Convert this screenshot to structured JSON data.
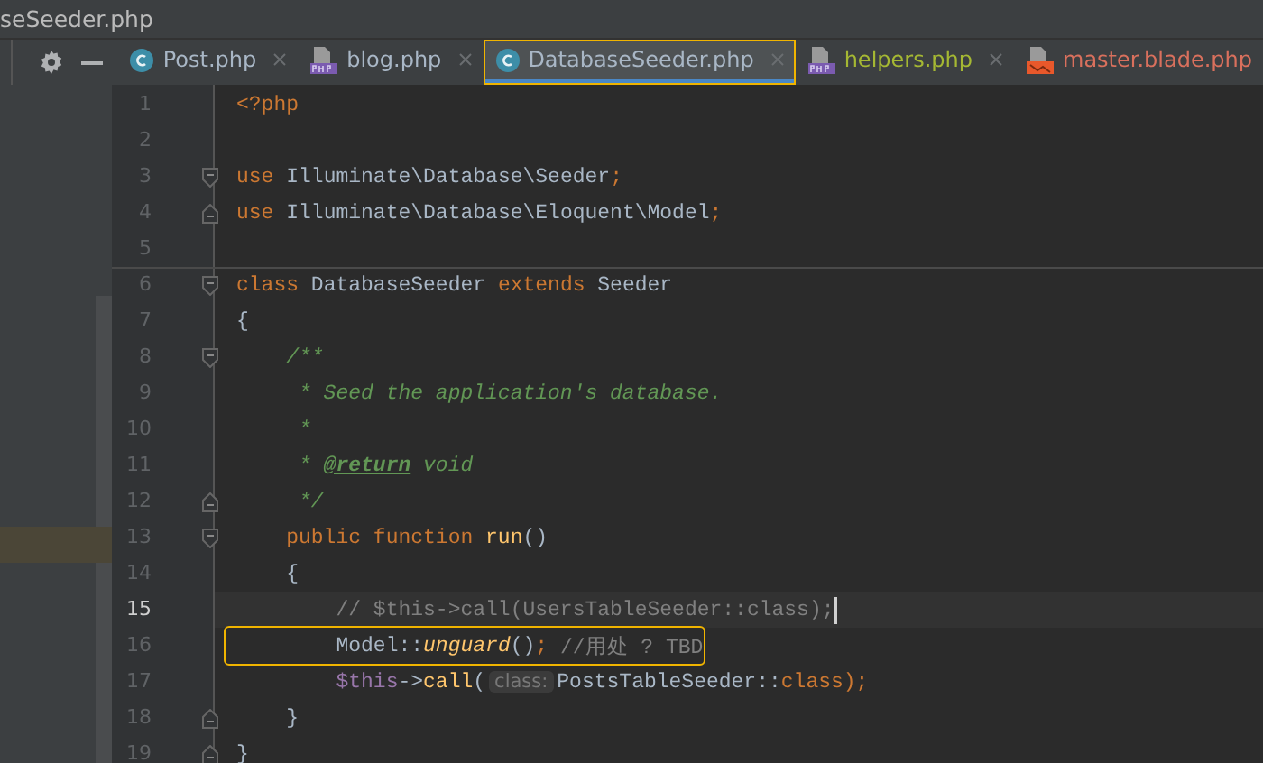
{
  "window": {
    "title": "seSeeder.php"
  },
  "tabs": [
    {
      "label": "Post.php",
      "kind": "class",
      "color": "#a9b7c6",
      "selected": false,
      "outlined": false,
      "closable": true
    },
    {
      "label": "blog.php",
      "kind": "php",
      "color": "#a9b7c6",
      "selected": false,
      "outlined": false,
      "closable": true
    },
    {
      "label": "DatabaseSeeder.php",
      "kind": "class",
      "color": "#a9b7c6",
      "selected": true,
      "outlined": true,
      "closable": true
    },
    {
      "label": "helpers.php",
      "kind": "php",
      "color": "#a5b833",
      "selected": false,
      "outlined": false,
      "closable": true
    },
    {
      "label": "master.blade.php",
      "kind": "blade",
      "color": "#d9705d",
      "selected": false,
      "outlined": false,
      "closable": false
    }
  ],
  "editor": {
    "lines": [
      {
        "number": "1",
        "kind": "plain",
        "tokens": [
          {
            "text": "<?php",
            "kind": "keyword"
          }
        ]
      },
      {
        "number": "2",
        "kind": "plain"
      },
      {
        "number": "3",
        "kind": "foldstart",
        "tokens": [
          {
            "text": "use",
            "kind": "keyword"
          },
          {
            "text": " Illuminate\\Database\\Seeder",
            "kind": "plain"
          },
          {
            "text": ";",
            "kind": "keyword"
          }
        ]
      },
      {
        "number": "4",
        "kind": "foldend",
        "tokens": [
          {
            "text": "use",
            "kind": "keyword"
          },
          {
            "text": " Illuminate\\Database\\Eloquent\\Model",
            "kind": "plain"
          },
          {
            "text": ";",
            "kind": "keyword"
          }
        ]
      },
      {
        "number": "5",
        "kind": "plain"
      },
      {
        "number": "6",
        "kind": "foldstart",
        "separator": true,
        "tokens": [
          {
            "text": "class",
            "kind": "keyword"
          },
          {
            "text": " DatabaseSeeder ",
            "kind": "plain"
          },
          {
            "text": "extends",
            "kind": "keyword"
          },
          {
            "text": " Seeder",
            "kind": "plain"
          }
        ]
      },
      {
        "number": "7",
        "kind": "plain",
        "tokens": [
          {
            "text": "{",
            "kind": "plain"
          }
        ]
      },
      {
        "number": "8",
        "kind": "foldstart",
        "tokens": [
          {
            "text": "    /**",
            "kind": "doc"
          }
        ]
      },
      {
        "number": "9",
        "kind": "plain",
        "tokens": [
          {
            "text": "     * Seed the application's database.",
            "kind": "doc"
          }
        ]
      },
      {
        "number": "10",
        "kind": "plain",
        "tokens": [
          {
            "text": "     *",
            "kind": "doc"
          }
        ]
      },
      {
        "number": "11",
        "kind": "plain",
        "tokens": [
          {
            "text": "     * ",
            "kind": "doc"
          },
          {
            "text": "@return",
            "kind": "doctag"
          },
          {
            "text": " void",
            "kind": "doc"
          }
        ]
      },
      {
        "number": "12",
        "kind": "foldend",
        "tokens": [
          {
            "text": "     */",
            "kind": "doc"
          }
        ]
      },
      {
        "number": "13",
        "kind": "foldstart",
        "tokens": [
          {
            "text": "    public function ",
            "kind": "keyword"
          },
          {
            "text": "run",
            "kind": "function"
          },
          {
            "text": "()",
            "kind": "plain"
          }
        ]
      },
      {
        "number": "14",
        "kind": "plain",
        "tokens": [
          {
            "text": "    {",
            "kind": "plain"
          }
        ]
      },
      {
        "number": "15",
        "kind": "plain",
        "current": true,
        "tokens": [
          {
            "text": "        // $this->call(UsersTableSeeder::class);",
            "kind": "comment"
          }
        ]
      },
      {
        "number": "16",
        "kind": "plain",
        "outlined": true,
        "tokens": [
          {
            "text": "        Model::",
            "kind": "plain"
          },
          {
            "text": "unguard",
            "kind": "method"
          },
          {
            "text": "()",
            "kind": "plain"
          },
          {
            "text": ";",
            "kind": "keyword"
          },
          {
            "text": " //用处 ? TBD",
            "kind": "comment"
          }
        ]
      },
      {
        "number": "17",
        "kind": "plain",
        "tokens": [
          {
            "text": "        $this",
            "kind": "variable"
          },
          {
            "text": "->",
            "kind": "plain"
          },
          {
            "text": "call",
            "kind": "function"
          },
          {
            "text": "(",
            "kind": "plain"
          },
          {
            "text": "class:",
            "kind": "hint"
          },
          {
            "text": "PostsTableSeeder::",
            "kind": "plain"
          },
          {
            "text": "class",
            "kind": "keyword"
          },
          {
            "text": ");",
            "kind": "keyword"
          }
        ]
      },
      {
        "number": "18",
        "kind": "foldend",
        "tokens": [
          {
            "text": "    }",
            "kind": "plain"
          }
        ]
      },
      {
        "number": "19",
        "kind": "foldend",
        "tokens": [
          {
            "text": "}",
            "kind": "plain"
          }
        ]
      }
    ]
  }
}
